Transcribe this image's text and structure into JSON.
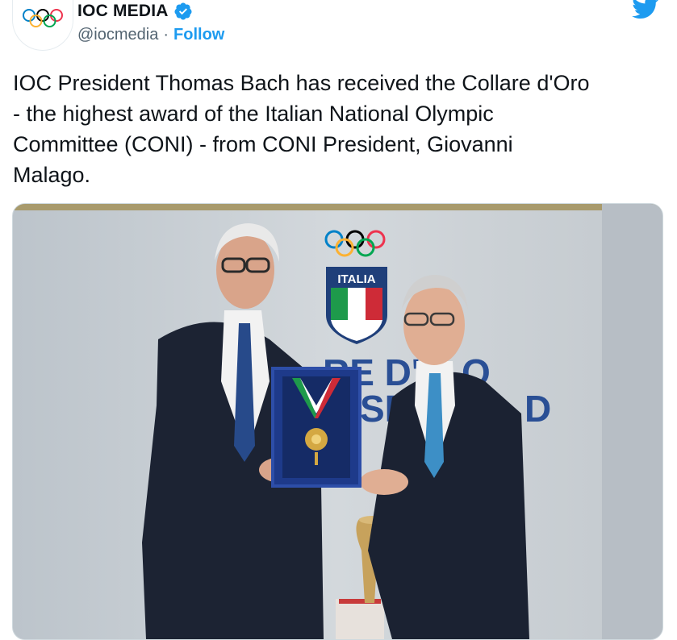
{
  "account": {
    "name": "IOC MEDIA",
    "handle": "@iocmedia",
    "separator": "·",
    "follow_label": "Follow",
    "verified": true,
    "avatar_icon": "olympic-rings-icon"
  },
  "tweet": {
    "text": "IOC President Thomas Bach has received the Collare d'Oro\n- the highest award of the Italian National Olympic\nCommittee (CONI) - from CONI President, Giovanni\nMalago."
  },
  "media": {
    "backdrop_text_line1": "RE D'",
    "backdrop_text_line1b": "O",
    "backdrop_text_line2": "SP",
    "backdrop_text_line2b": "D",
    "shield_label": "ITALIA"
  },
  "colors": {
    "accent": "#1d9bf0",
    "text": "#0f1419",
    "secondary": "#536471",
    "twitter_blue": "#1d9bf0"
  }
}
